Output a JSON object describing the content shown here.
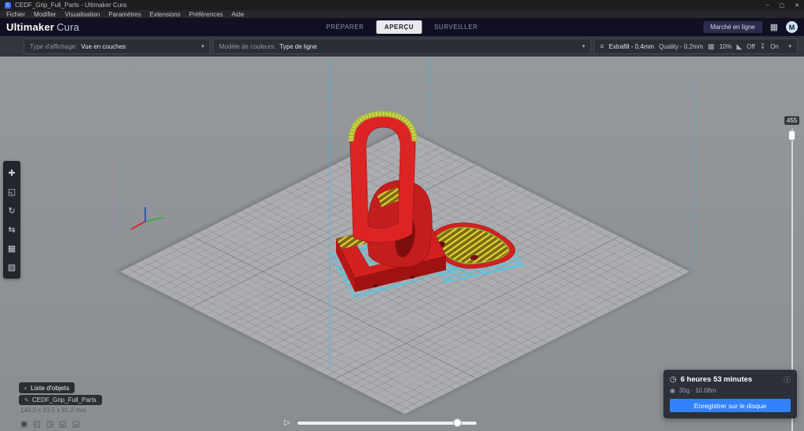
{
  "window": {
    "app_icon": "C",
    "title": "CEDF_Grip_Full_Parts - Ultimaker Cura",
    "minimize": "–",
    "maximize": "▢",
    "close": "✕"
  },
  "menu": {
    "items": [
      "Fichier",
      "Modifier",
      "Visualisation",
      "Paramètres",
      "Extensions",
      "Préférences",
      "Aide"
    ]
  },
  "header": {
    "brand_primary": "Ultimaker",
    "brand_secondary": "Cura",
    "stages": [
      {
        "label": "PRÉPARER"
      },
      {
        "label": "APERÇU"
      },
      {
        "label": "SURVEILLER"
      }
    ],
    "active_stage": "APERÇU",
    "marketplace": "Marché en ligne",
    "grid_icon": "▦",
    "avatar": "M"
  },
  "viewbar": {
    "view_type_label": "Type d'affichage:",
    "view_type_value": "Vue en couches",
    "color_scheme_label": "Modèle de couleurs:",
    "color_scheme_value": "Type de ligne",
    "chevron": "▾",
    "settings_icon": "≡",
    "material": "Extrafill - 0.4mm",
    "profile": "Quality - 0.2mm",
    "infill_icon": "▦",
    "infill": "10%",
    "support_icon": "◣",
    "support": "Off",
    "adhesion_icon": "↧",
    "adhesion": "On"
  },
  "tools": {
    "items": [
      {
        "name": "move",
        "glyph": "✚"
      },
      {
        "name": "scale",
        "glyph": "◱"
      },
      {
        "name": "rotate",
        "glyph": "↻"
      },
      {
        "name": "mirror",
        "glyph": "⇆"
      },
      {
        "name": "per-model-settings",
        "glyph": "▦"
      },
      {
        "name": "support-blocker",
        "glyph": "▨"
      }
    ]
  },
  "layer_slider": {
    "value": "455"
  },
  "simulation": {
    "play_icon": "▷"
  },
  "object_list": {
    "collapse_icon": "‹",
    "title": "Liste d'objets",
    "edit_icon": "✎",
    "item_name": "CEDF_Grip_Full_Parts",
    "item_dims": "140.0 x 93.5 x 91.2 mm"
  },
  "view_presets": {
    "items": [
      {
        "name": "3d",
        "glyph": "▣"
      },
      {
        "name": "front",
        "glyph": "◰"
      },
      {
        "name": "top",
        "glyph": "◳"
      },
      {
        "name": "left",
        "glyph": "◱"
      },
      {
        "name": "right",
        "glyph": "◲"
      }
    ]
  },
  "job": {
    "clock_icon": "◷",
    "duration": "6 heures 53 minutes",
    "info_icon": "ⓘ",
    "spool_icon": "◉",
    "material_usage": "30g · 10.08m",
    "save_label": "Enregistrer sur le disque"
  },
  "colors": {
    "accent_blue": "#3282ff",
    "model_red": "#d32020",
    "skin_yellow": "#e3d43c",
    "brim_cyan": "#4cc9ea",
    "plate_gray": "#abadb0"
  }
}
